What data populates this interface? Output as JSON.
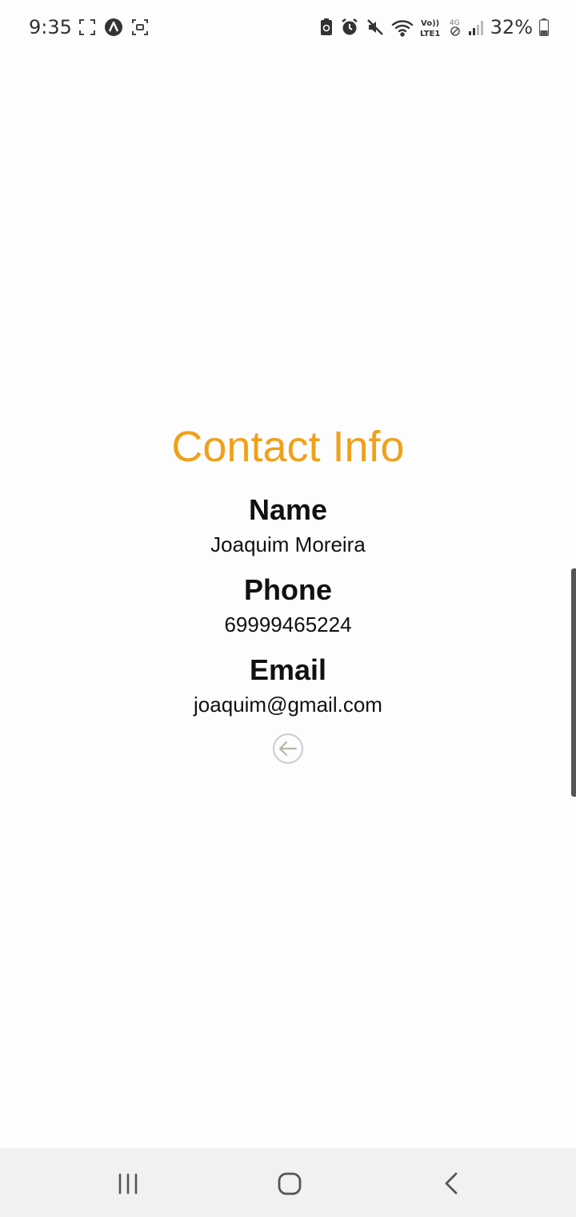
{
  "status_bar": {
    "time": "9:35",
    "battery": "32%",
    "left_icons": [
      "screenshot-frame-icon",
      "app-notification-icon",
      "screen-capture-icon"
    ],
    "right_icons": [
      "battery-saver-icon",
      "alarm-icon",
      "mute-icon",
      "wifi-icon",
      "volte-icon",
      "mobile-data-icon",
      "signal-icon",
      "battery-icon"
    ],
    "volte_text": "Vo)) LTE1",
    "data_text": "4G"
  },
  "contact": {
    "title": "Contact Info",
    "name_label": "Name",
    "name_value": "Joaquim Moreira",
    "phone_label": "Phone",
    "phone_value": "69999465224",
    "email_label": "Email",
    "email_value": "joaquim@gmail.com"
  },
  "colors": {
    "title": "#f0a01a",
    "background": "#fdfdfe",
    "nav_bar": "#f1f1f3"
  },
  "nav_bar": {
    "buttons": [
      "recents-icon",
      "home-icon",
      "back-icon"
    ]
  }
}
